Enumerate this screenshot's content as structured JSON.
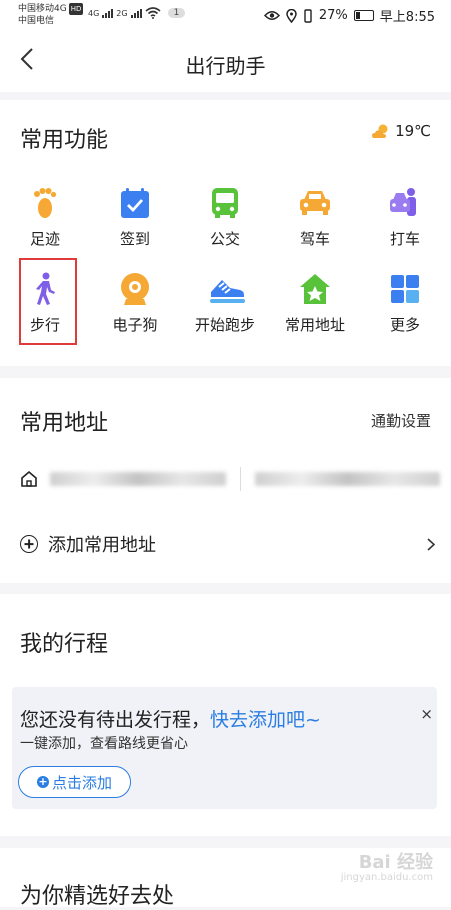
{
  "status_bar": {
    "carrier1": "中国移动4G",
    "hd": "HD",
    "carrier2": "中国电信",
    "net1": "4G",
    "net2": "2G",
    "notif_count": "1",
    "battery": "27%",
    "time": "早上8:55"
  },
  "header": {
    "title": "出行助手",
    "back_icon": "chevron-left-icon"
  },
  "functions": {
    "title": "常用功能",
    "weather_temp": "19℃",
    "items": [
      {
        "label": "足迹",
        "icon": "footprint-icon",
        "color": "#f5a833"
      },
      {
        "label": "签到",
        "icon": "checkin-icon",
        "color": "#3b7ff0"
      },
      {
        "label": "公交",
        "icon": "bus-icon",
        "color": "#58c23a"
      },
      {
        "label": "驾车",
        "icon": "car-icon",
        "color": "#f5a833"
      },
      {
        "label": "打车",
        "icon": "taxi-icon",
        "color": "#7f5ee8"
      },
      {
        "label": "步行",
        "icon": "walk-icon",
        "color": "#7f5ee8"
      },
      {
        "label": "电子狗",
        "icon": "edog-icon",
        "color": "#f5a833"
      },
      {
        "label": "开始跑步",
        "icon": "running-shoe-icon",
        "color": "#3b7ff0"
      },
      {
        "label": "常用地址",
        "icon": "home-star-icon",
        "color": "#58c23a"
      },
      {
        "label": "更多",
        "icon": "more-grid-icon",
        "color": "#3b7ff0"
      }
    ]
  },
  "addresses": {
    "title": "常用地址",
    "commute_link": "通勤设置",
    "add_label": "添加常用地址"
  },
  "trips": {
    "title": "我的行程",
    "empty_text": "您还没有待出发行程，",
    "empty_link": "快去添加吧~",
    "subtitle": "一键添加，查看路线更省心",
    "add_button": "点击添加",
    "close": "×"
  },
  "recommend": {
    "title": "为你精选好去处"
  },
  "watermark": {
    "line1": "Bai 经验",
    "line2": "jingyan.baidu.com"
  }
}
